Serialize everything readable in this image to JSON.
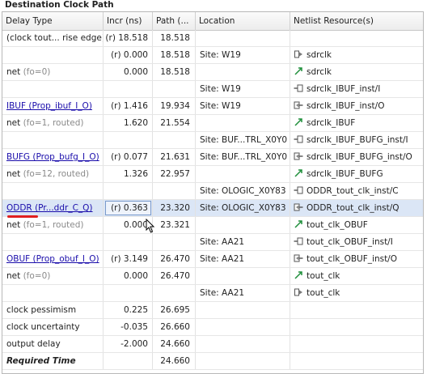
{
  "panel": {
    "title": "Destination Clock Path"
  },
  "columns": [
    "Delay Type",
    "Incr (ns)",
    "Path (...",
    "Location",
    "Netlist Resource(s)"
  ],
  "rows": [
    {
      "type": "(clock tout... rise edge)",
      "incr": "(r) 18.518",
      "path": "18.518",
      "loc": "",
      "res": "",
      "icon": ""
    },
    {
      "type": "",
      "incr": "(r) 0.000",
      "path": "18.518",
      "loc": "Site: W19",
      "res": "sdrclk",
      "icon": "port-in-icon"
    },
    {
      "type": "net (fo=0)",
      "incr": "0.000",
      "path": "18.518",
      "loc": "",
      "res": "sdrclk",
      "icon": "net-arrow-icon"
    },
    {
      "type": "",
      "incr": "",
      "path": "",
      "loc": "Site: W19",
      "res": "sdrclk_IBUF_inst/I",
      "icon": "pin-in-icon"
    },
    {
      "type": "IBUF (Prop_ibuf_I_O)",
      "incr": "(r) 1.416",
      "path": "19.934",
      "loc": "Site: W19",
      "res": "sdrclk_IBUF_inst/O",
      "icon": "pin-out-icon",
      "link": true
    },
    {
      "type": "net (fo=1, routed)",
      "incr": "1.620",
      "path": "21.554",
      "loc": "",
      "res": "sdrclk_IBUF",
      "icon": "net-arrow-icon"
    },
    {
      "type": "",
      "incr": "",
      "path": "",
      "loc": "Site: BUF...TRL_X0Y0",
      "res": "sdrclk_IBUF_BUFG_inst/I",
      "icon": "pin-in-icon"
    },
    {
      "type": "BUFG (Prop_bufg_I_O)",
      "incr": "(r) 0.077",
      "path": "21.631",
      "loc": "Site: BUF...TRL_X0Y0",
      "res": "sdrclk_IBUF_BUFG_inst/O",
      "icon": "pin-out-icon",
      "link": true
    },
    {
      "type": "net (fo=12, routed)",
      "incr": "1.326",
      "path": "22.957",
      "loc": "",
      "res": "sdrclk_IBUF_BUFG",
      "icon": "net-arrow-icon"
    },
    {
      "type": "",
      "incr": "",
      "path": "",
      "loc": "Site: OLOGIC_X0Y83",
      "res": "ODDR_tout_clk_inst/C",
      "icon": "pin-in-icon"
    },
    {
      "type": "ODDR (Pr...ddr_C_Q)",
      "incr": "(r) 0.363",
      "path": "23.320",
      "loc": "Site: OLOGIC_X0Y83",
      "res": "ODDR_tout_clk_inst/Q",
      "icon": "pin-out-icon",
      "link": true,
      "selected": true
    },
    {
      "type": "net (fo=1, routed)",
      "incr": "0.000",
      "path": "23.321",
      "loc": "",
      "res": "tout_clk_OBUF",
      "icon": "net-arrow-icon"
    },
    {
      "type": "",
      "incr": "",
      "path": "",
      "loc": "Site: AA21",
      "res": "tout_clk_OBUF_inst/I",
      "icon": "pin-in-icon"
    },
    {
      "type": "OBUF (Prop_obuf_I_O)",
      "incr": "(r) 3.149",
      "path": "26.470",
      "loc": "Site: AA21",
      "res": "tout_clk_OBUF_inst/O",
      "icon": "pin-out-icon",
      "link": true
    },
    {
      "type": "net (fo=0)",
      "incr": "0.000",
      "path": "26.470",
      "loc": "",
      "res": "tout_clk",
      "icon": "net-arrow-icon"
    },
    {
      "type": "",
      "incr": "",
      "path": "",
      "loc": "Site: AA21",
      "res": "tout_clk",
      "icon": "port-out-icon"
    },
    {
      "type": "clock pessimism",
      "incr": "0.225",
      "path": "26.695",
      "loc": "",
      "res": "",
      "icon": ""
    },
    {
      "type": "clock uncertainty",
      "incr": "-0.035",
      "path": "26.660",
      "loc": "",
      "res": "",
      "icon": ""
    },
    {
      "type": "output delay",
      "incr": "-2.000",
      "path": "24.660",
      "loc": "",
      "res": "",
      "icon": ""
    },
    {
      "type": "Required Time",
      "incr": "",
      "path": "24.660",
      "loc": "",
      "res": "",
      "icon": "",
      "bold": true
    }
  ]
}
